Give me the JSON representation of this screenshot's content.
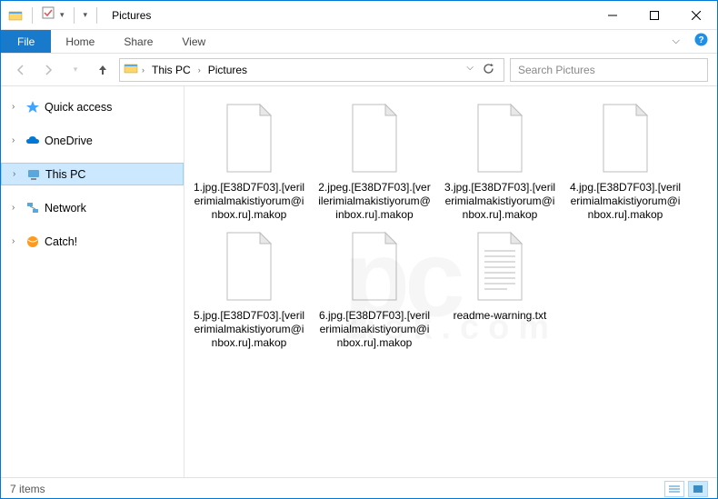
{
  "window": {
    "title": "Pictures"
  },
  "ribbon": {
    "file": "File",
    "tabs": [
      "Home",
      "Share",
      "View"
    ]
  },
  "breadcrumb": {
    "segments": [
      "This PC",
      "Pictures"
    ]
  },
  "search": {
    "placeholder": "Search Pictures"
  },
  "sidebar": {
    "items": [
      {
        "label": "Quick access",
        "caret": "›",
        "icon": "star",
        "color": "#40a3ff"
      },
      {
        "label": "OneDrive",
        "caret": "›",
        "icon": "cloud",
        "color": "#0078d7"
      },
      {
        "label": "This PC",
        "caret": "›",
        "icon": "monitor",
        "color": "#5aa7dc",
        "selected": true
      },
      {
        "label": "Network",
        "caret": "›",
        "icon": "network",
        "color": "#5aa7dc"
      },
      {
        "label": "Catch!",
        "caret": "›",
        "icon": "ball",
        "color": "#ff9a1f"
      }
    ]
  },
  "files": [
    {
      "name": "1.jpg.[E38D7F03].[verilerimialmakistiyorum@inbox.ru].makop",
      "icon": "blank"
    },
    {
      "name": "2.jpeg.[E38D7F03].[verilerimialmakistiyorum@inbox.ru].makop",
      "icon": "blank"
    },
    {
      "name": "3.jpg.[E38D7F03].[verilerimialmakistiyorum@inbox.ru].makop",
      "icon": "blank"
    },
    {
      "name": "4.jpg.[E38D7F03].[verilerimialmakistiyorum@inbox.ru].makop",
      "icon": "blank"
    },
    {
      "name": "5.jpg.[E38D7F03].[verilerimialmakistiyorum@inbox.ru].makop",
      "icon": "blank"
    },
    {
      "name": "6.jpg.[E38D7F03].[verilerimialmakistiyorum@inbox.ru].makop",
      "icon": "blank"
    },
    {
      "name": "readme-warning.txt",
      "icon": "text"
    }
  ],
  "status": {
    "count": "7 items"
  },
  "watermark": {
    "main": "pc",
    "sub": "risk.com"
  }
}
